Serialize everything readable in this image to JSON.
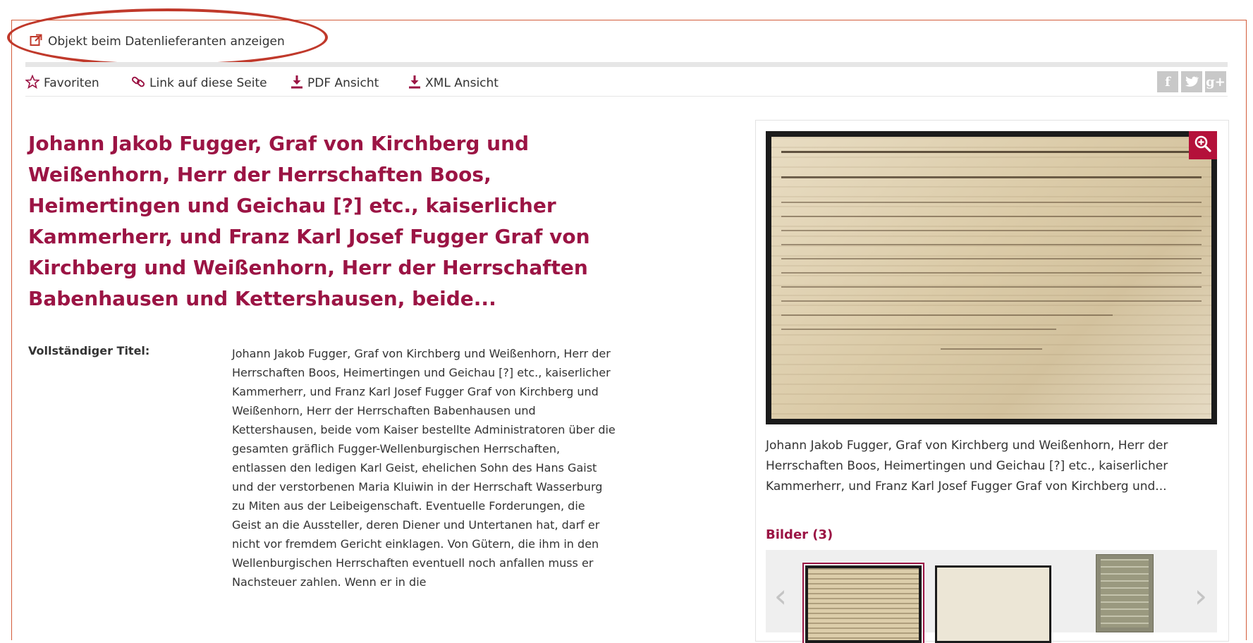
{
  "external_link": {
    "label": "Objekt beim Datenlieferanten anzeigen",
    "icon": "external-link-icon"
  },
  "toolbar": {
    "favoriten": "Favoriten",
    "link": "Link auf diese Seite",
    "pdf": "PDF Ansicht",
    "xml": "XML Ansicht",
    "social": [
      "f",
      "t",
      "g+"
    ]
  },
  "main": {
    "title": "Johann Jakob Fugger, Graf von Kirchberg und Weißenhorn, Herr der Herrschaften Boos, Heimertingen und Geichau [?] etc., kaiserlicher Kammerherr, und Franz Karl Josef Fugger Graf von Kirchberg und Weißenhorn, Herr der Herrschaften Babenhausen und Kettershausen, beide...",
    "field_label": "Vollständiger Titel:",
    "field_value": "Johann Jakob Fugger, Graf von Kirchberg und Weißenhorn, Herr der Herrschaften Boos, Heimertingen und Geichau [?] etc., kaiserlicher Kammerherr, und Franz Karl Josef Fugger Graf von Kirchberg und Weißenhorn, Herr der Herrschaften Babenhausen und Kettershausen, beide vom Kaiser bestellte Administratoren über die gesamten gräflich Fugger-Wellenburgischen Herrschaften, entlassen den ledigen Karl Geist, ehelichen Sohn des Hans Gaist und der verstorbenen Maria Kluiwin in der Herrschaft Wasserburg zu Miten aus der Leibeigenschaft. Eventuelle Forderungen, die Geist an die Aussteller, deren Diener und Untertanen hat, darf er nicht vor fremdem Gericht einklagen. Von Gütern, die ihm in den Wellenburgischen Herrschaften eventuell noch anfallen muss er Nachsteuer zahlen. Wenn er in die"
  },
  "preview": {
    "caption": "Johann Jakob Fugger, Graf von Kirchberg und Weißenhorn, Herr der Herrschaften Boos, Heimertingen und Geichau [?] etc., kaiserlicher Kammerherr, und Franz Karl Josef Fugger Graf von Kirchberg und...",
    "bilder_heading": "Bilder (3)"
  },
  "colors": {
    "accent": "#9b1444",
    "frame": "#d35c3a",
    "oval": "#c0392b",
    "zoom_bg": "#b4113a"
  }
}
